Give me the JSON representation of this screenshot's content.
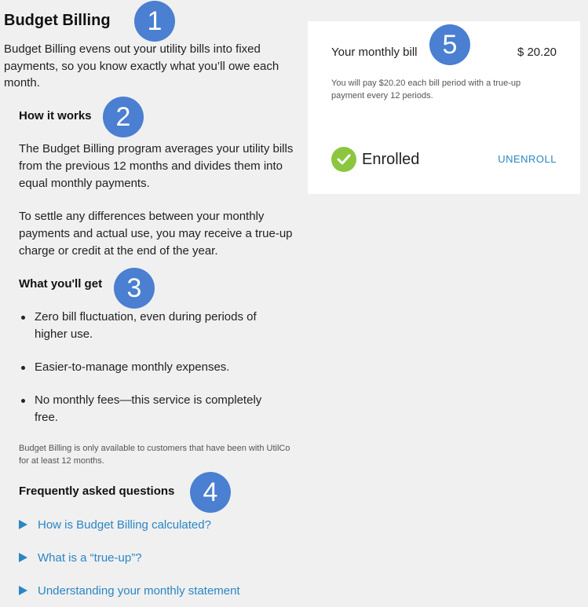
{
  "page": {
    "title": "Budget Billing",
    "intro": "Budget Billing evens out your utility bills into fixed payments, so you know exactly what you’ll owe each month."
  },
  "how_it_works": {
    "heading": "How it works",
    "paragraphs": [
      "The Budget Billing program averages your utility bills from the previous 12 months and divides them into equal monthly payments.",
      "To settle any differences between your monthly payments and actual use, you may receive a true-up charge or credit at the end of the year."
    ]
  },
  "what_you_get": {
    "heading": "What you'll get",
    "items": [
      "Zero bill fluctuation, even during periods of higher use.",
      "Easier-to-manage monthly expenses.",
      "No monthly fees—this service is completely free."
    ]
  },
  "disclaimer": "Budget Billing is only available to customers that have been with UtilCo for at least 12 months.",
  "faq": {
    "heading": "Frequently asked questions",
    "items": [
      "How is Budget Billing calculated?",
      "What is a “true-up”?",
      "Understanding your monthly statement"
    ]
  },
  "bill_card": {
    "label": "Your monthly bill",
    "amount": "$ 20.20",
    "note": "You will pay $20.20 each bill period with a true-up payment every 12 periods.",
    "status": "Enrolled",
    "action": "UNENROLL"
  },
  "badges": [
    "1",
    "2",
    "3",
    "4",
    "5"
  ],
  "colors": {
    "link": "#2a86c4",
    "badge": "#4a7fd1",
    "check": "#8cc63f",
    "background": "#f0f0f0",
    "card": "#ffffff"
  },
  "icons": {
    "faq_expand": "triangle-right-icon",
    "status": "check-circle-icon"
  }
}
